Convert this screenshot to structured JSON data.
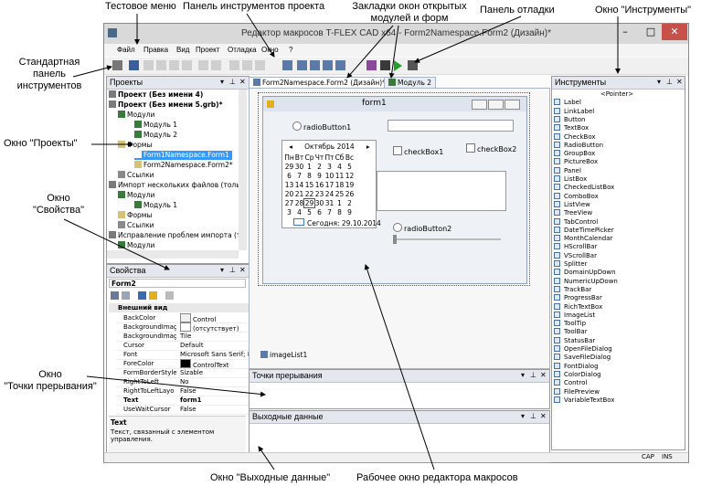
{
  "annotations": {
    "menu": "Тестовое меню",
    "toolbar_project": "Панель инструментов проекта",
    "tabs_line1": "Закладки окон открытых",
    "tabs_line2": "модулей и форм",
    "debug": "Панель отладки",
    "tools": "Окно \"Инструменты\"",
    "std_line1": "Стандартная",
    "std_line2": "панель",
    "std_line3": "инструментов",
    "projects": "Окно \"Проекты\"",
    "props_line1": "Окно",
    "props_line2": "\"Свойства\"",
    "bp_line1": "Окно",
    "bp_line2": "\"Точки прерывания\"",
    "output": "Окно \"Выходные данные\"",
    "editor": "Рабочее окно редактора макросов"
  },
  "window": {
    "title": "Редактор макросов T-FLEX CAD x64 - Form2Namespace.Form2 (Дизайн)*",
    "minimize": "–",
    "maximize": "□",
    "close": "✕",
    "menu": [
      "Файл",
      "Правка",
      "Вид",
      "Проект",
      "Отладка",
      "Окно",
      "?"
    ]
  },
  "projects": {
    "title": "Проекты",
    "rows": [
      "Проект (Без имени 4)",
      "Проект (Без имени 5.grb)*",
      "Модули",
      "Модуль 1",
      "Модуль 2",
      "Формы",
      "Form1Namespace.Form1",
      "Form2Namespace.Form2*",
      "Ссылки",
      "Импорт нескольких файлов (тольк",
      "Модули",
      "Модуль 1",
      "Формы",
      "Ссылки",
      "Исправление проблем импорта (то",
      "Модули"
    ]
  },
  "properties": {
    "title": "Свойства",
    "object": "Form2",
    "section": "Внешний вид",
    "rows": [
      [
        "BackColor",
        "Control"
      ],
      [
        "BackgroundImag",
        "(отсутствует)"
      ],
      [
        "BackgroundImag",
        "Tile"
      ],
      [
        "Cursor",
        "Default"
      ],
      [
        "Font",
        "Microsoft Sans Serif; 8,2"
      ],
      [
        "ForeColor",
        "ControlText"
      ],
      [
        "FormBorderStyle",
        "Sizable"
      ],
      [
        "RightToLeft",
        "No"
      ],
      [
        "RightToLeftLayo",
        "False"
      ],
      [
        "Text",
        "form1"
      ],
      [
        "UseWaitCursor",
        "False"
      ]
    ],
    "desc_title": "Text",
    "desc_text1": "Текст, связанный с элементом",
    "desc_text2": "управления."
  },
  "tabs": [
    "Form2Namespace.Form2 (Дизайн)*",
    "Модуль 2"
  ],
  "form": {
    "title": "form1",
    "radio1": "radioButton1",
    "radio2": "radioButton2",
    "check1": "checkBox1",
    "check2": "checkBox2",
    "cal_month": "Октябрь 2014",
    "cal_days": [
      "Пн",
      "Вт",
      "Ср",
      "Чт",
      "Пт",
      "Сб",
      "Вс"
    ],
    "cal_weeks": [
      [
        "29",
        "30",
        "1",
        "2",
        "3",
        "4",
        "5"
      ],
      [
        "6",
        "7",
        "8",
        "9",
        "10",
        "11",
        "12"
      ],
      [
        "13",
        "14",
        "15",
        "16",
        "17",
        "18",
        "19"
      ],
      [
        "20",
        "21",
        "22",
        "23",
        "24",
        "25",
        "26"
      ],
      [
        "27",
        "28",
        "29",
        "30",
        "31",
        "1",
        "2"
      ],
      [
        "3",
        "4",
        "5",
        "6",
        "7",
        "8",
        "9"
      ]
    ],
    "today": "Сегодня: 29.10.2014",
    "component": "imageList1"
  },
  "breakpoints": {
    "title": "Точки прерывания"
  },
  "output": {
    "title": "Выходные данные"
  },
  "tools": {
    "title": "Инструменты",
    "items": [
      "<Pointer>",
      "Label",
      "LinkLabel",
      "Button",
      "TextBox",
      "CheckBox",
      "RadioButton",
      "GroupBox",
      "PictureBox",
      "Panel",
      "ListBox",
      "CheckedListBox",
      "ComboBox",
      "ListView",
      "TreeView",
      "TabControl",
      "DateTimePicker",
      "MonthCalendar",
      "HScrollBar",
      "VScrollBar",
      "Splitter",
      "DomainUpDown",
      "NumericUpDown",
      "TrackBar",
      "ProgressBar",
      "RichTextBox",
      "ImageList",
      "ToolTip",
      "ToolBar",
      "StatusBar",
      "OpenFileDialog",
      "SaveFileDialog",
      "FontDialog",
      "ColorDialog",
      "Control",
      "FilePreview",
      "VariableTextBox"
    ]
  },
  "status": {
    "cap": "CAP",
    "ins": "INS"
  },
  "colors": {
    "accent": "#3c7fb1",
    "selection": "#3399ff",
    "panel_header": "#e4e8ee"
  }
}
